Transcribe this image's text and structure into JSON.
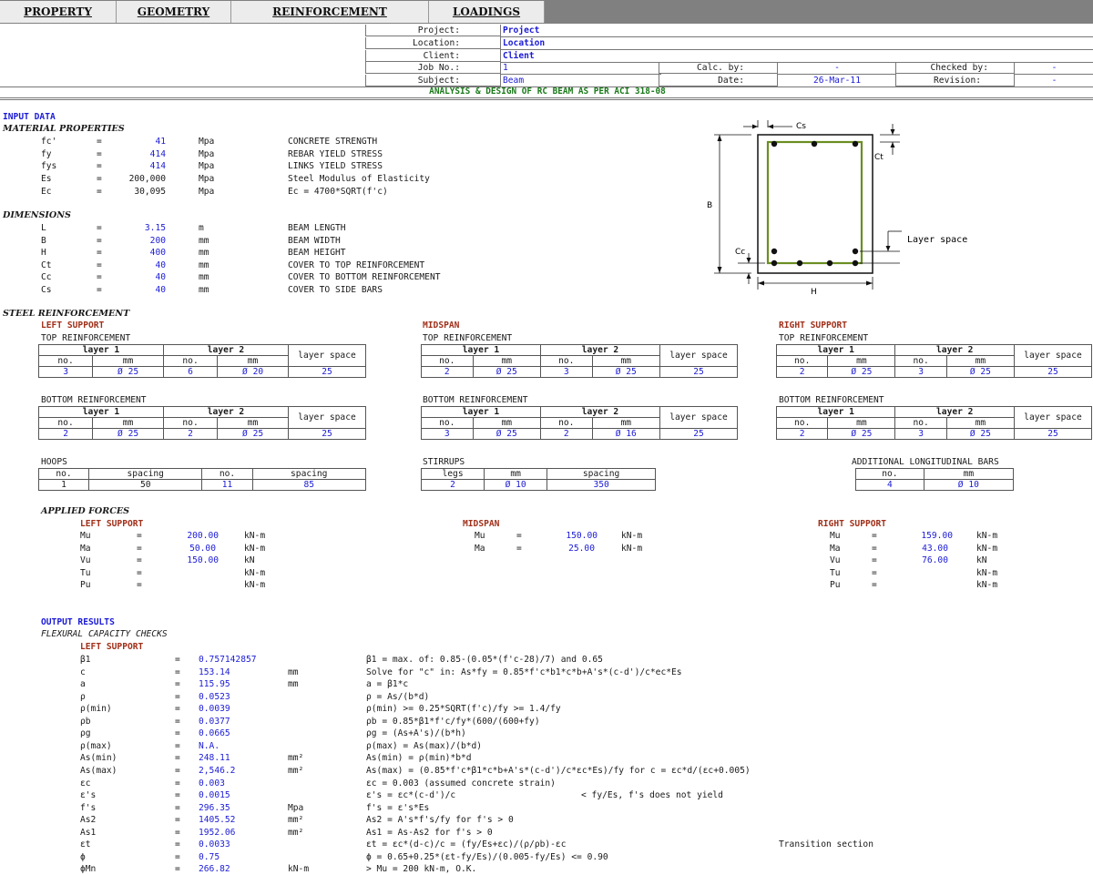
{
  "tabs": [
    "PROPERTY",
    "GEOMETRY",
    "REINFORCEMENT",
    "LOADINGS"
  ],
  "header": {
    "project_label": "Project:",
    "project_value": "Project",
    "location_label": "Location:",
    "location_value": "Location",
    "client_label": "Client:",
    "client_value": "Client",
    "jobno_label": "Job No.:",
    "jobno_value": "1",
    "calcby_label": "Calc. by:",
    "calcby_value": "-",
    "checkedby_label": "Checked by:",
    "checkedby_value": "-",
    "subject_label": "Subject:",
    "subject_value": "Beam",
    "date_label": "Date:",
    "date_value": "26-Mar-11",
    "revision_label": "Revision:",
    "revision_value": "-",
    "title": "ANALYSIS & DESIGN OF RC BEAM AS PER ACI 318-08"
  },
  "input_title": "INPUT DATA",
  "material_title": "MATERIAL PROPERTIES",
  "material": [
    {
      "sym": "fc'",
      "value": "41",
      "unit": "Mpa",
      "desc": "CONCRETE STRENGTH"
    },
    {
      "sym": "fy",
      "value": "414",
      "unit": "Mpa",
      "desc": "REBAR YIELD STRESS"
    },
    {
      "sym": "fys",
      "value": "414",
      "unit": "Mpa",
      "desc": "LINKS YIELD STRESS"
    },
    {
      "sym": "Es",
      "value": "200,000",
      "unit": "Mpa",
      "desc": "Steel Modulus of Elasticity"
    },
    {
      "sym": "Ec",
      "value": "30,095",
      "unit": "Mpa",
      "desc": "Ec = 4700*SQRT(f'c)"
    }
  ],
  "dimensions_title": "DIMENSIONS",
  "dimensions": [
    {
      "sym": "L",
      "value": "3.15",
      "unit": "m",
      "desc": "BEAM LENGTH"
    },
    {
      "sym": "B",
      "value": "200",
      "unit": "mm",
      "desc": "BEAM WIDTH"
    },
    {
      "sym": "H",
      "value": "400",
      "unit": "mm",
      "desc": "BEAM HEIGHT"
    },
    {
      "sym": "Ct",
      "value": "40",
      "unit": "mm",
      "desc": "COVER TO TOP REINFORCEMENT"
    },
    {
      "sym": "Cc",
      "value": "40",
      "unit": "mm",
      "desc": "COVER TO BOTTOM REINFORCEMENT"
    },
    {
      "sym": "Cs",
      "value": "40",
      "unit": "mm",
      "desc": "COVER TO SIDE BARS"
    }
  ],
  "diagram": {
    "cs": "Cs",
    "ct": "Ct",
    "b": "B",
    "cc": "Cc",
    "h": "H",
    "layer_space": "Layer space"
  },
  "steel_title": "STEEL REINFORCEMENT",
  "rebar_labels": {
    "top": "TOP REINFORCEMENT",
    "bottom": "BOTTOM REINFORCEMENT",
    "layer1": "layer 1",
    "layer2": "layer 2",
    "layer_space": "layer space",
    "no": "no.",
    "mm": "mm"
  },
  "left_support": {
    "title": "LEFT SUPPORT",
    "top": {
      "n1": "3",
      "d1": "Ø 25",
      "n2": "6",
      "d2": "Ø 20",
      "space": "25"
    },
    "bottom": {
      "n1": "2",
      "d1": "Ø 25",
      "n2": "2",
      "d2": "Ø 25",
      "space": "25"
    }
  },
  "midspan": {
    "title": "MIDSPAN",
    "top": {
      "n1": "2",
      "d1": "Ø 25",
      "n2": "3",
      "d2": "Ø 25",
      "space": "25"
    },
    "bottom": {
      "n1": "3",
      "d1": "Ø 25",
      "n2": "2",
      "d2": "Ø 16",
      "space": "25"
    }
  },
  "right_support": {
    "title": "RIGHT SUPPORT",
    "top": {
      "n1": "2",
      "d1": "Ø 25",
      "n2": "3",
      "d2": "Ø 25",
      "space": "25"
    },
    "bottom": {
      "n1": "2",
      "d1": "Ø 25",
      "n2": "3",
      "d2": "Ø 25",
      "space": "25"
    }
  },
  "hoops": {
    "title": "HOOPS",
    "h_no": "no.",
    "h_spacing": "spacing",
    "no1": "1",
    "sp1": "50",
    "no2": "11",
    "sp2": "85"
  },
  "stirrups": {
    "title": "STIRRUPS",
    "h_legs": "legs",
    "h_mm": "mm",
    "h_spacing": "spacing",
    "legs": "2",
    "dia": "Ø 10",
    "spacing": "350"
  },
  "additional": {
    "title": "ADDITIONAL LONGITUDINAL BARS",
    "h_no": "no.",
    "h_mm": "mm",
    "no": "4",
    "dia": "Ø 10"
  },
  "forces_title": "APPLIED FORCES",
  "forces_left": {
    "title": "LEFT SUPPORT",
    "rows": [
      {
        "sym": "Mu",
        "value": "200.00",
        "unit": "kN-m"
      },
      {
        "sym": "Ma",
        "value": "50.00",
        "unit": "kN-m"
      },
      {
        "sym": "Vu",
        "value": "150.00",
        "unit": "kN"
      },
      {
        "sym": "Tu",
        "value": "",
        "unit": "kN-m"
      },
      {
        "sym": "Pu",
        "value": "",
        "unit": "kN-m"
      }
    ]
  },
  "forces_mid": {
    "title": "MIDSPAN",
    "rows": [
      {
        "sym": "Mu",
        "value": "150.00",
        "unit": "kN-m"
      },
      {
        "sym": "Ma",
        "value": "25.00",
        "unit": "kN-m"
      }
    ]
  },
  "forces_right": {
    "title": "RIGHT SUPPORT",
    "rows": [
      {
        "sym": "Mu",
        "value": "159.00",
        "unit": "kN-m"
      },
      {
        "sym": "Ma",
        "value": "43.00",
        "unit": "kN-m"
      },
      {
        "sym": "Vu",
        "value": "76.00",
        "unit": "kN"
      },
      {
        "sym": "Tu",
        "value": "",
        "unit": "kN-m"
      },
      {
        "sym": "Pu",
        "value": "",
        "unit": "kN-m"
      }
    ]
  },
  "output_title": "OUTPUT RESULTS",
  "flexural_title": "FLEXURAL CAPACITY CHECKS",
  "flexural_left_title": "LEFT SUPPORT",
  "equals": "=",
  "results": [
    {
      "sym": "β1",
      "value": "0.757142857",
      "unit": "",
      "formula": "β1 = max. of: 0.85-(0.05*(f'c-28)/7) and 0.65",
      "note": ""
    },
    {
      "sym": "c",
      "value": "153.14",
      "unit": "mm",
      "formula": "Solve for \"c\" in: As*fy = 0.85*f'c*b1*c*b+A's*(c-d')/c*ec*Es",
      "note": ""
    },
    {
      "sym": "a",
      "value": "115.95",
      "unit": "mm",
      "formula": "a = β1*c",
      "note": ""
    },
    {
      "sym": "ρ",
      "value": "0.0523",
      "unit": "",
      "formula": "ρ = As/(b*d)",
      "note": ""
    },
    {
      "sym": "ρ(min)",
      "value": "0.0039",
      "unit": "",
      "formula": "ρ(min) >= 0.25*SQRT(f'c)/fy >= 1.4/fy",
      "note": ""
    },
    {
      "sym": "ρb",
      "value": "0.0377",
      "unit": "",
      "formula": "ρb = 0.85*β1*f'c/fy*(600/(600+fy)",
      "note": ""
    },
    {
      "sym": "ρg",
      "value": "0.0665",
      "unit": "",
      "formula": "ρg = (As+A's)/(b*h)",
      "note": ""
    },
    {
      "sym": "ρ(max)",
      "value": "N.A.",
      "unit": "",
      "formula": "ρ(max) = As(max)/(b*d)",
      "note": ""
    },
    {
      "sym": "As(min)",
      "value": "248.11",
      "unit": "mm²",
      "formula": "As(min) = ρ(min)*b*d",
      "note": ""
    },
    {
      "sym": "As(max)",
      "value": "2,546.2",
      "unit": "mm²",
      "formula": "As(max) = (0.85*f'c*β1*c*b+A's*(c-d')/c*εc*Es)/fy   for c = εc*d/(εc+0.005)",
      "note": ""
    },
    {
      "sym": "εc",
      "value": "0.003",
      "unit": "",
      "formula": "εc = 0.003 (assumed concrete strain)",
      "note": ""
    },
    {
      "sym": "ε's",
      "value": "0.0015",
      "unit": "",
      "formula": "ε's = εc*(c-d')/c",
      "note": "< fy/Es, f's does not yield"
    },
    {
      "sym": "f's",
      "value": "296.35",
      "unit": "Mpa",
      "formula": "f's = ε's*Es",
      "note": ""
    },
    {
      "sym": "As2",
      "value": "1405.52",
      "unit": "mm²",
      "formula": "As2 = A's*f's/fy  for f's > 0",
      "note": ""
    },
    {
      "sym": "As1",
      "value": "1952.06",
      "unit": "mm²",
      "formula": "As1 = As-As2  for f's > 0",
      "note": ""
    },
    {
      "sym": "εt",
      "value": "0.0033",
      "unit": "",
      "formula": "εt = εc*(d-c)/c = (fy/Es+εc)/(ρ/ρb)-εc",
      "note": "Transition section"
    },
    {
      "sym": "ϕ",
      "value": "0.75",
      "unit": "",
      "formula": "ϕ = 0.65+0.25*(εt-fy/Es)/(0.005-fy/Es) <= 0.90",
      "note": ""
    },
    {
      "sym": "ϕMn",
      "value": "266.82",
      "unit": "kN-m",
      "formula": "> Mu = 200 kN-m, O.K.",
      "note": ""
    }
  ],
  "colors": {
    "value_blue": "#1b1bd6",
    "section_red": "#a0301a",
    "title_green": "#1a7a1a",
    "stirrup_green": "#6b8e23"
  }
}
